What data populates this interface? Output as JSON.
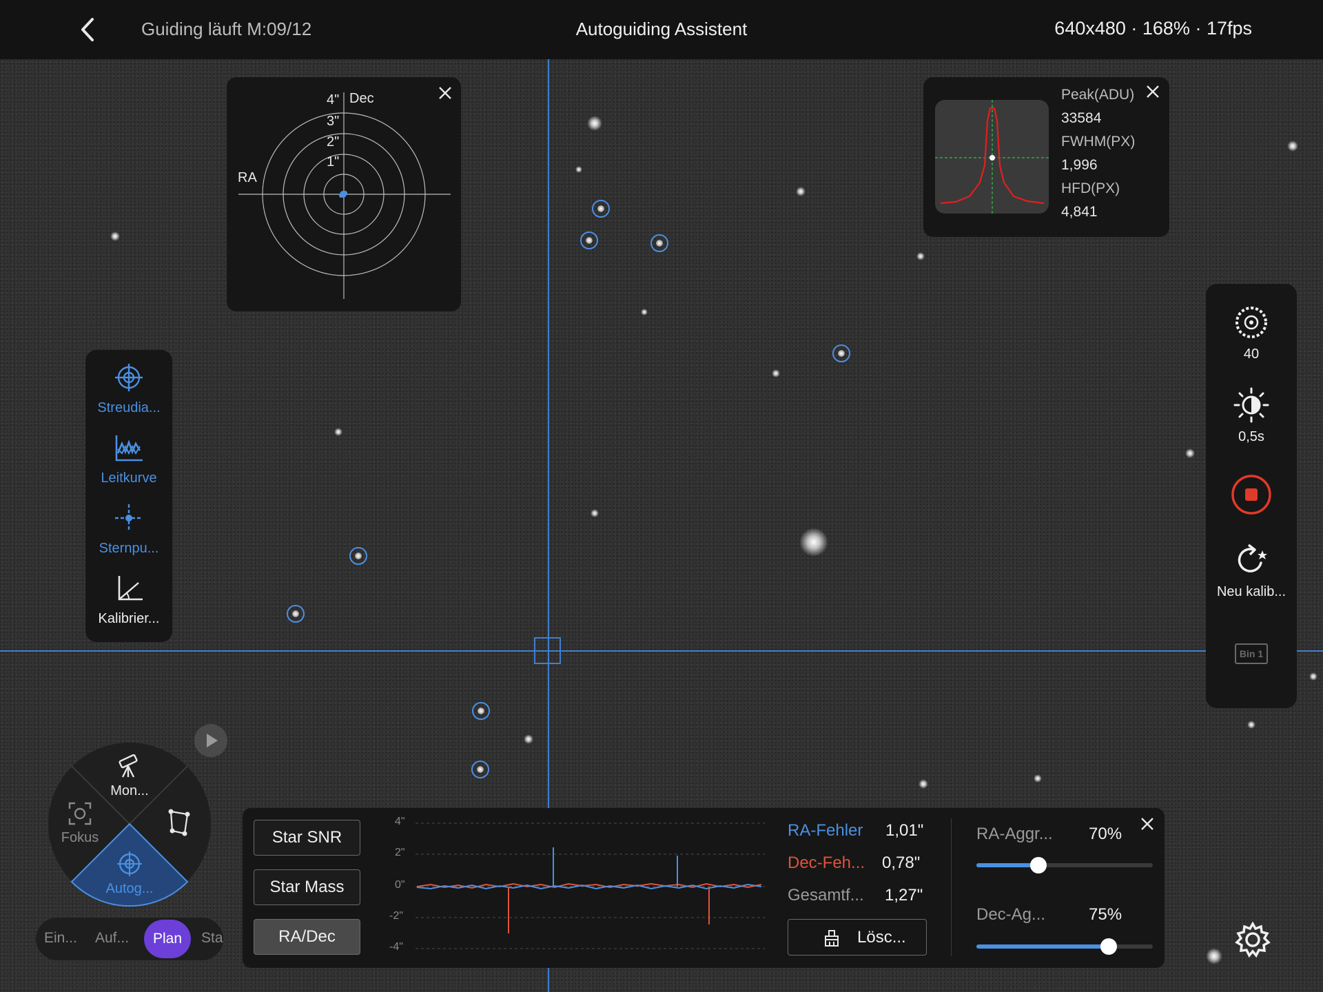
{
  "topbar": {
    "status": "Guiding läuft M:09/12",
    "title": "Autoguiding Assistent",
    "info": "640x480 · 168% · 17fps"
  },
  "scatter_panel": {
    "label_ra": "RA",
    "label_dec": "Dec",
    "ring_labels": [
      "4\"",
      "3\"",
      "2\"",
      "1\""
    ]
  },
  "star_profile": {
    "peak_label": "Peak(ADU)",
    "peak_value": "33584",
    "fwhm_label": "FWHM(PX)",
    "fwhm_value": "1,996",
    "hfd_label": "HFD(PX)",
    "hfd_value": "4,841"
  },
  "left_toolbar": [
    {
      "label": "Streudia...",
      "icon": "crosshair-icon",
      "active": true
    },
    {
      "label": "Leitkurve",
      "icon": "graph-icon",
      "active": true
    },
    {
      "label": "Sternpu...",
      "icon": "star-point-icon",
      "active": true
    },
    {
      "label": "Kalibrier...",
      "icon": "calibration-angle-icon",
      "active": false
    }
  ],
  "right_toolbar": {
    "gain_value": "40",
    "exposure_value": "0,5s",
    "recalibrate_label": "Neu kalib...",
    "bin_label": "Bin 1"
  },
  "mode_wheel": {
    "mount_label": "Mon...",
    "focus_label": "Fokus",
    "autoguide_label": "Autog..."
  },
  "mode_tabs": {
    "tab1": "Ein...",
    "tab2": "Auf...",
    "tab3": "Plan",
    "tab4": "Sta"
  },
  "graph_panel": {
    "btn_snr": "Star SNR",
    "btn_mass": "Star Mass",
    "btn_radec": "RA/Dec",
    "y_ticks": [
      "4\"",
      "2\"",
      "0\"",
      "-2\"",
      "-4\""
    ],
    "ra_error_label": "RA-Fehler",
    "ra_error_value": "1,01\"",
    "dec_error_label": "Dec-Feh...",
    "dec_error_value": "0,78\"",
    "total_error_label": "Gesamtf...",
    "total_error_value": "1,27\"",
    "clear_label": "Lösc...",
    "ra_aggr_label": "RA-Aggr...",
    "ra_aggr_value": "70%",
    "ra_aggr": 0.35,
    "dec_aggr_label": "Dec-Ag...",
    "dec_aggr_value": "75%",
    "dec_aggr": 0.75
  },
  "colors": {
    "accent": "#4a90e2",
    "ra": "#4a90e2",
    "dec": "#e0533a",
    "record": "#e03a2a",
    "tab_active": "#6b3fd8"
  }
}
